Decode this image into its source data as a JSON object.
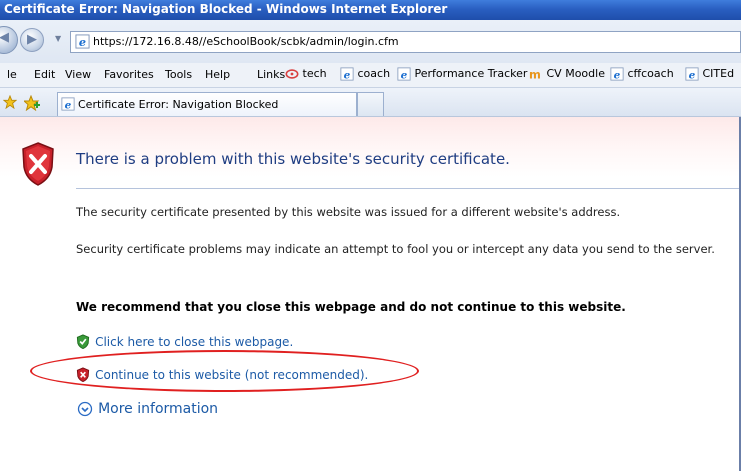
{
  "window": {
    "title": "Certificate Error: Navigation Blocked - Windows Internet Explorer"
  },
  "address_bar": {
    "url": "https://172.16.8.48//eSchoolBook/scbk/admin/login.cfm"
  },
  "menu": {
    "items": [
      "le",
      "Edit",
      "View",
      "Favorites",
      "Tools",
      "Help"
    ],
    "links_label": "Links",
    "links": [
      {
        "label": "tech",
        "icon": "aol-icon"
      },
      {
        "label": "coach",
        "icon": "ie-page-icon"
      },
      {
        "label": "Performance Tracker",
        "icon": "ie-page-icon"
      },
      {
        "label": "CV Moodle",
        "icon": "moodle-icon"
      },
      {
        "label": "cffcoach",
        "icon": "ie-page-icon"
      },
      {
        "label": "CITEd",
        "icon": "ie-page-icon"
      }
    ]
  },
  "tabs": [
    {
      "label": "Certificate Error: Navigation Blocked"
    }
  ],
  "page": {
    "heading": "There is a problem with this website's security certificate.",
    "para1": "The security certificate presented by this website was issued for a different website's address.",
    "para2": "Security certificate problems may indicate an attempt to fool you or intercept any data you send to the server.",
    "recommend": "We recommend that you close this webpage and do not continue to this website.",
    "close_link": "Click here to close this webpage.",
    "continue_link": "Continue to this website (not recommended).",
    "more_info": "More information"
  },
  "colors": {
    "heading": "#1f3d82",
    "link": "#1c5aa6",
    "annotation": "#e02020",
    "titlebar": "#2a5fc1"
  }
}
